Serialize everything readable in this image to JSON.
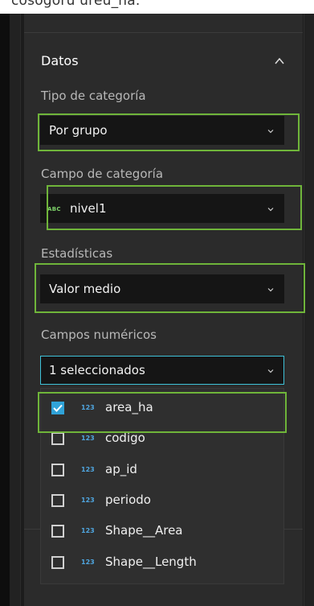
{
  "top_strip": {
    "text": "cosogoru ureu_na."
  },
  "section": {
    "title": "Datos"
  },
  "category_type": {
    "label": "Tipo de categoría",
    "value": "Por grupo"
  },
  "category_field": {
    "label": "Campo de categoría",
    "type_badge": "ABC",
    "value": "nivel1"
  },
  "statistics": {
    "label": "Estadísticas",
    "value": "Valor medio"
  },
  "numeric_fields": {
    "label": "Campos numéricos",
    "value": "1 seleccionados",
    "options": [
      {
        "type_badge": "123",
        "label": "area_ha",
        "checked": true
      },
      {
        "type_badge": "123",
        "label": "codigo",
        "checked": false
      },
      {
        "type_badge": "123",
        "label": "ap_id",
        "checked": false
      },
      {
        "type_badge": "123",
        "label": "periodo",
        "checked": false
      },
      {
        "type_badge": "123",
        "label": "Shape__Area",
        "checked": false
      },
      {
        "type_badge": "123",
        "label": "Shape__Length",
        "checked": false
      }
    ]
  },
  "colors": {
    "highlight": "#6fb53a",
    "accent_checkbox": "#30a3d8",
    "focus_border": "#3ec2d8",
    "string_badge": "#7fd46a",
    "number_badge": "#4fa6e0"
  }
}
